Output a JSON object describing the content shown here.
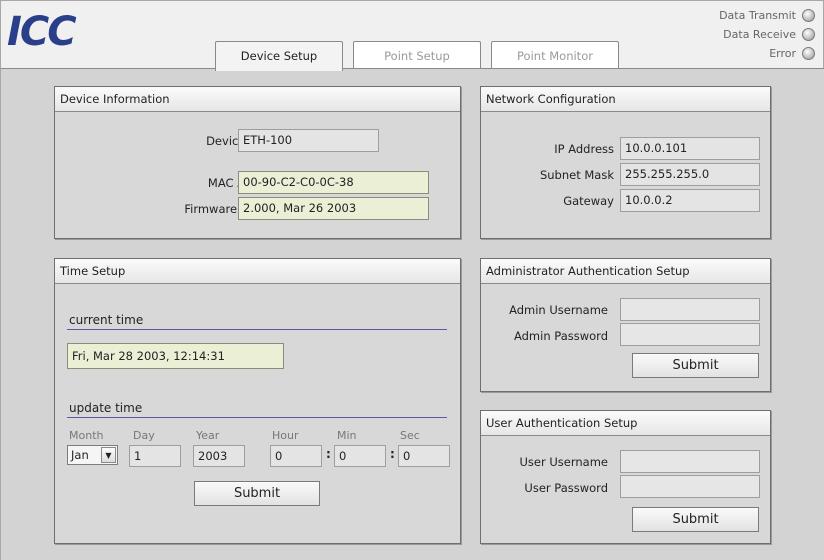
{
  "header": {
    "logo_text": "ICC",
    "tabs": [
      {
        "label": "Device Setup",
        "active": true
      },
      {
        "label": "Point Setup",
        "active": false
      },
      {
        "label": "Point Monitor",
        "active": false
      }
    ],
    "indicators": [
      {
        "label": "Data Transmit"
      },
      {
        "label": "Data Receive"
      },
      {
        "label": "Error"
      }
    ]
  },
  "device_info": {
    "title": "Device Information",
    "device_name_label": "Device Name",
    "device_name": "ETH-100",
    "mac_label": "MAC Address",
    "mac": "00-90-C2-C0-0C-38",
    "firmware_label": "Firmware Version",
    "firmware": "2.000, Mar 26 2003"
  },
  "network": {
    "title": "Network Configuration",
    "ip_label": "IP Address",
    "ip": "10.0.0.101",
    "subnet_label": "Subnet Mask",
    "subnet": "255.255.255.0",
    "gateway_label": "Gateway",
    "gateway": "10.0.0.2"
  },
  "time_setup": {
    "title": "Time Setup",
    "current_heading": "current time",
    "current_time": "Fri, Mar 28 2003, 12:14:31",
    "update_heading": "update time",
    "labels": {
      "month": "Month",
      "day": "Day",
      "year": "Year",
      "hour": "Hour",
      "min": "Min",
      "sec": "Sec"
    },
    "values": {
      "month": "Jan",
      "day": "1",
      "year": "2003",
      "hour": "0",
      "min": "0",
      "sec": "0"
    },
    "colon": ":",
    "submit": "Submit"
  },
  "admin_auth": {
    "title": "Administrator Authentication Setup",
    "username_label": "Admin Username",
    "password_label": "Admin Password",
    "submit": "Submit"
  },
  "user_auth": {
    "title": "User Authentication Setup",
    "username_label": "User Username",
    "password_label": "User Password",
    "submit": "Submit"
  }
}
